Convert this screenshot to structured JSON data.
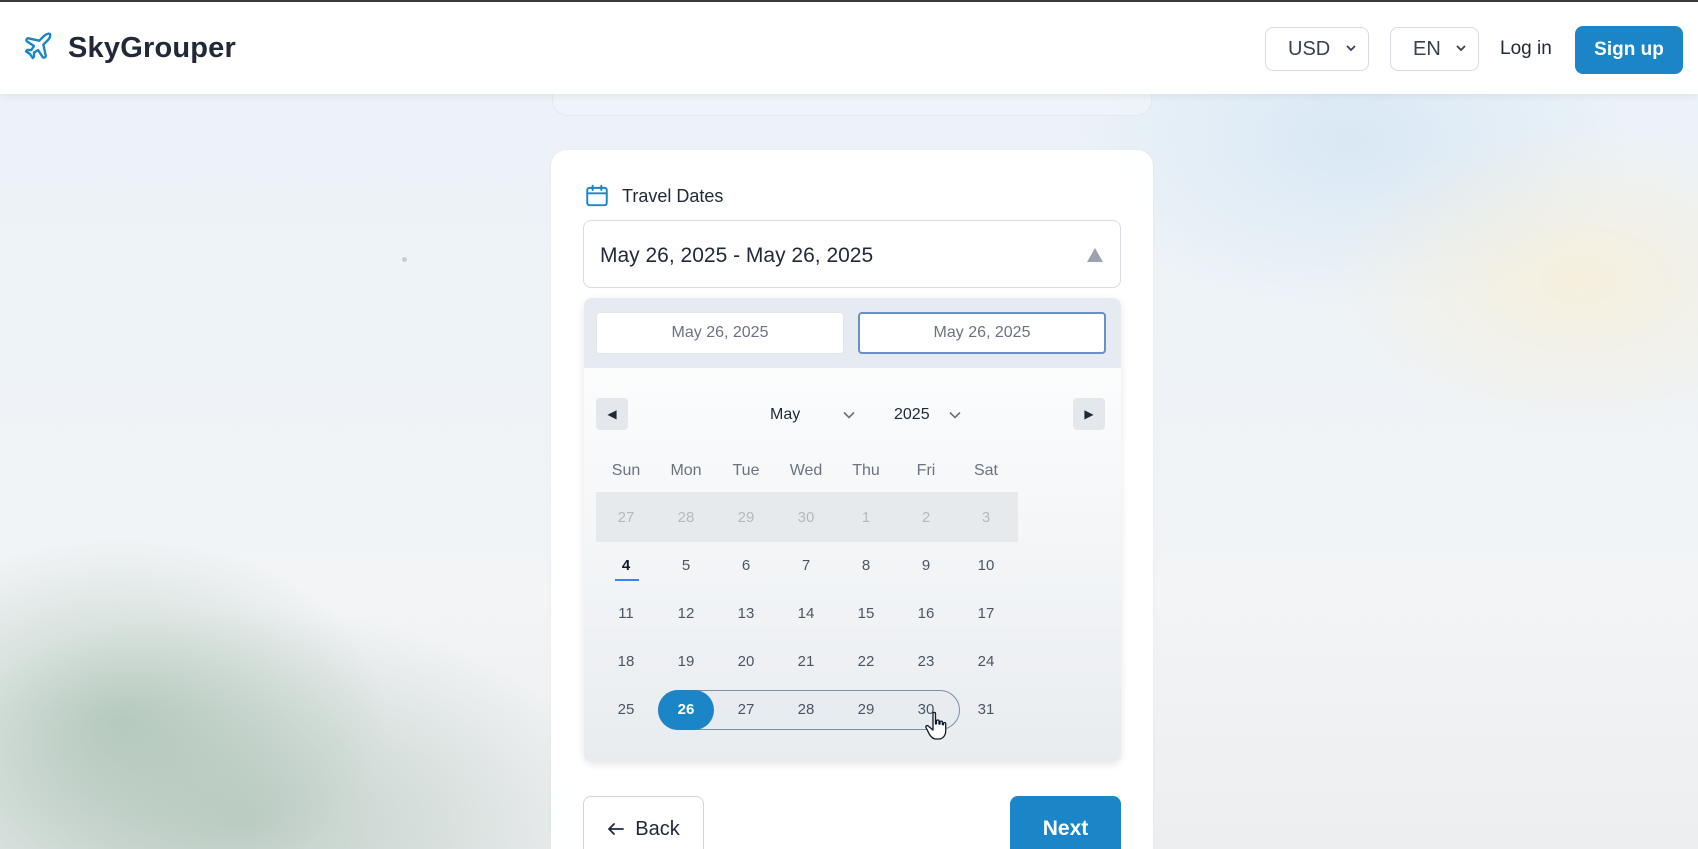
{
  "brand": {
    "name": "SkyGrouper",
    "accent": "#1a86c7"
  },
  "header": {
    "currency": "USD",
    "language": "EN",
    "login_label": "Log in",
    "signup_label": "Sign up"
  },
  "travel_dates": {
    "label": "Travel Dates",
    "value": "May 26, 2025 - May 26, 2025"
  },
  "picker": {
    "start_input": "May 26, 2025",
    "end_input": "May 26, 2025",
    "month": "May",
    "year": "2025",
    "weekdays": [
      "Sun",
      "Mon",
      "Tue",
      "Wed",
      "Thu",
      "Fri",
      "Sat"
    ],
    "weeks": [
      [
        "27",
        "28",
        "29",
        "30",
        "1",
        "2",
        "3"
      ],
      [
        "4",
        "5",
        "6",
        "7",
        "8",
        "9",
        "10"
      ],
      [
        "11",
        "12",
        "13",
        "14",
        "15",
        "16",
        "17"
      ],
      [
        "18",
        "19",
        "20",
        "21",
        "22",
        "23",
        "24"
      ],
      [
        "25",
        "26",
        "27",
        "28",
        "29",
        "30",
        "31"
      ]
    ],
    "today": "4",
    "selected": "26",
    "hover_range_end": "30"
  },
  "actions": {
    "back_label": "Back",
    "next_label": "Next"
  }
}
